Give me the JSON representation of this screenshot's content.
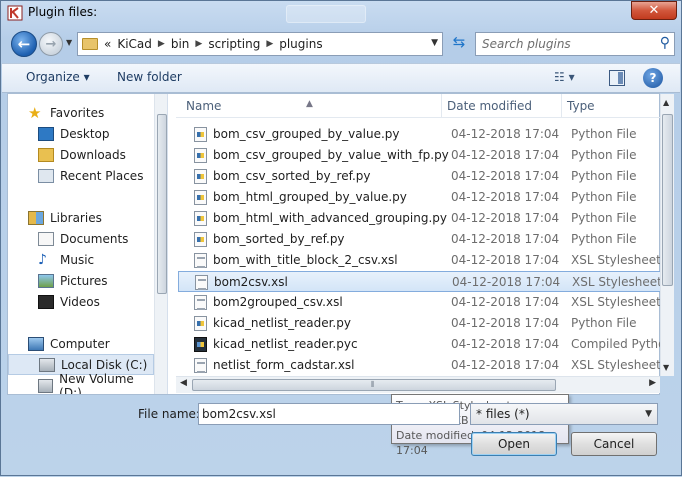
{
  "window": {
    "title": "Plugin files:"
  },
  "address": {
    "crumbs": [
      "KiCad",
      "bin",
      "scripting",
      "plugins"
    ],
    "prefix": "«"
  },
  "search": {
    "placeholder": "Search plugins"
  },
  "toolbar": {
    "organize": "Organize ▾",
    "new_folder": "New folder"
  },
  "nav": {
    "items": [
      {
        "label": "Favorites",
        "icon": "star-icon"
      },
      {
        "label": "Desktop",
        "icon": "desktop-icon"
      },
      {
        "label": "Downloads",
        "icon": "downloads-folder-icon"
      },
      {
        "label": "Recent Places",
        "icon": "recent-places-icon"
      },
      {
        "label": "Libraries",
        "icon": "libraries-icon"
      },
      {
        "label": "Documents",
        "icon": "documents-icon"
      },
      {
        "label": "Music",
        "icon": "music-icon"
      },
      {
        "label": "Pictures",
        "icon": "pictures-icon"
      },
      {
        "label": "Videos",
        "icon": "videos-icon"
      },
      {
        "label": "Computer",
        "icon": "computer-icon"
      },
      {
        "label": "Local Disk (C:)",
        "icon": "disk-icon"
      },
      {
        "label": "New Volume (D:)",
        "icon": "disk-icon"
      }
    ]
  },
  "columns": {
    "name": "Name",
    "date": "Date modified",
    "type": "Type"
  },
  "files": [
    {
      "name": "bom_csv_grouped_by_value.py",
      "date": "04-12-2018 17:04",
      "type": "Python File"
    },
    {
      "name": "bom_csv_grouped_by_value_with_fp.py",
      "date": "04-12-2018 17:04",
      "type": "Python File"
    },
    {
      "name": "bom_csv_sorted_by_ref.py",
      "date": "04-12-2018 17:04",
      "type": "Python File"
    },
    {
      "name": "bom_html_grouped_by_value.py",
      "date": "04-12-2018 17:04",
      "type": "Python File"
    },
    {
      "name": "bom_html_with_advanced_grouping.py",
      "date": "04-12-2018 17:04",
      "type": "Python File"
    },
    {
      "name": "bom_sorted_by_ref.py",
      "date": "04-12-2018 17:04",
      "type": "Python File"
    },
    {
      "name": "bom_with_title_block_2_csv.xsl",
      "date": "04-12-2018 17:04",
      "type": "XSL Stylesheet"
    },
    {
      "name": "bom2csv.xsl",
      "date": "04-12-2018 17:04",
      "type": "XSL Stylesheet"
    },
    {
      "name": "bom2grouped_csv.xsl",
      "date": "04-12-2018 17:04",
      "type": "XSL Stylesheet"
    },
    {
      "name": "kicad_netlist_reader.py",
      "date": "04-12-2018 17:04",
      "type": "Python File"
    },
    {
      "name": "kicad_netlist_reader.pyc",
      "date": "04-12-2018 17:04",
      "type": "Compiled Python"
    },
    {
      "name": "netlist_form_cadstar.xsl",
      "date": "04-12-2018 17:04",
      "type": "XSL Stylesheet"
    }
  ],
  "tooltip": {
    "type": "Type: XSL Stylesheet",
    "size": "Size: 3.61 KB",
    "modified": "Date modified: 04-12-2018 17:04"
  },
  "footer": {
    "filename_label": "File name:",
    "filename_value": "bom2csv.xsl",
    "filetype": "* files (*)",
    "open": "Open",
    "cancel": "Cancel"
  }
}
